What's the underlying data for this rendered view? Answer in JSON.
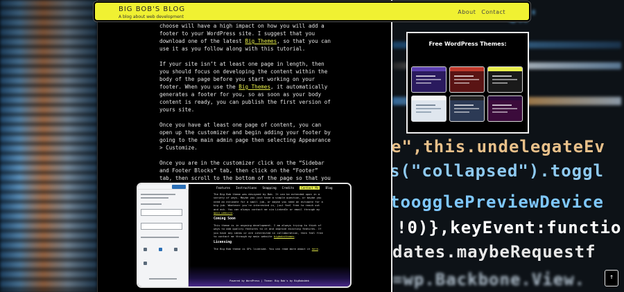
{
  "header": {
    "site_title": "Big Bob's Blog",
    "tagline": "A blog about web development",
    "nav": [
      "About",
      "Contact"
    ]
  },
  "article": {
    "p1_a": "choose will have a high impact on how you will add a footer to your WordPress site. I suggest that you download one of the latest ",
    "p1_link": "Big Themes",
    "p1_b": ", so that you can use it as you follow along with this tutorial.",
    "p2_a": "If your site isn’t at least one page in length, then you should focus on developing the content within the body of the page before you start working on your footer. When you use the ",
    "p2_link": "Big Themes",
    "p2_b": ", it automatically generates a footer for you, so as soon as your body content is ready, you can publish the first version of yours site.",
    "p3": "Once you have at least one page of content, you can open up the customizer and begin adding your footer by going to the main admin page then selecting Appearance > Customize.",
    "p4": "Once you are in the customizer click on the “Sidebar and Footer Blocks” tab, then click on the “Footer” tab, then scroll to the bottom of the page so that you can see your footer."
  },
  "screenshot": {
    "menu": [
      "Features",
      "Instructions",
      "Snapping",
      "Credits",
      "Contact Me",
      "Blog"
    ],
    "active_menu": "Contact Me",
    "intro": "The Big Bob theme was designed by Bob. It can be extended upon in a variety of ways. Maybe you just have a simple question, or maybe you need an estimate for a small job, or maybe you need an estimate for a big job. Whatever you're interested in, just feel free to reach out and ask. You can always contact me via LinkedIn or email through my ",
    "intro_link": "main website",
    "h_coming": "Coming Soon",
    "coming": "This theme is in ongoing development. I am always trying to think of ways to add quality features to it and improve existing features. If you have any ideas or are interested in collaboration, then feel free to contact me through my main website ",
    "coming_link": "bigbobsthemes",
    "h_license": "Licensing",
    "license": "The Big Bob theme is GPL licensed. You can read more about it ",
    "license_link": "here",
    "footer": "Powered by WordPress | Theme: Big Bob's by BigBobsWeb"
  },
  "widget": {
    "title": "Free WordPress Themes:",
    "themes": [
      {
        "name": "theme-1",
        "top": "#5b3fb0",
        "bg": "#2a1a5e"
      },
      {
        "name": "theme-2",
        "top": "#c0392b",
        "bg": "#5a1414"
      },
      {
        "name": "theme-3",
        "top": "#e8ee4a",
        "bg": "#1a1a1a"
      },
      {
        "name": "theme-4",
        "top": "#f5f5f5",
        "bg": "#dfe6ee"
      },
      {
        "name": "theme-5",
        "top": "#222222",
        "bg": "#2c3a55"
      },
      {
        "name": "theme-6",
        "top": "#2a0b3a",
        "bg": "#3b0b3b"
      }
    ]
  },
  "scroll_top": "↑",
  "background_code": [
    {
      "text": "'ck'",
      "color": "#6ec3ff"
    },
    {
      "text": "e\",this.undelegateEv",
      "color": "#e8c08a"
    },
    {
      "text": "s(\"collapsed\").toggl",
      "color": "#8ecaf2"
    },
    {
      "text": "toogglePreviewDevice",
      "color": "#7fc8ff"
    },
    {
      "text": "!0)},keyEvent:functio",
      "color": "#ffffff"
    },
    {
      "text": "dates.maybeRequestf",
      "color": "#e8e8e8"
    },
    {
      "text": "=wp.Backbone.View.",
      "color": "#d5e6f5"
    }
  ]
}
